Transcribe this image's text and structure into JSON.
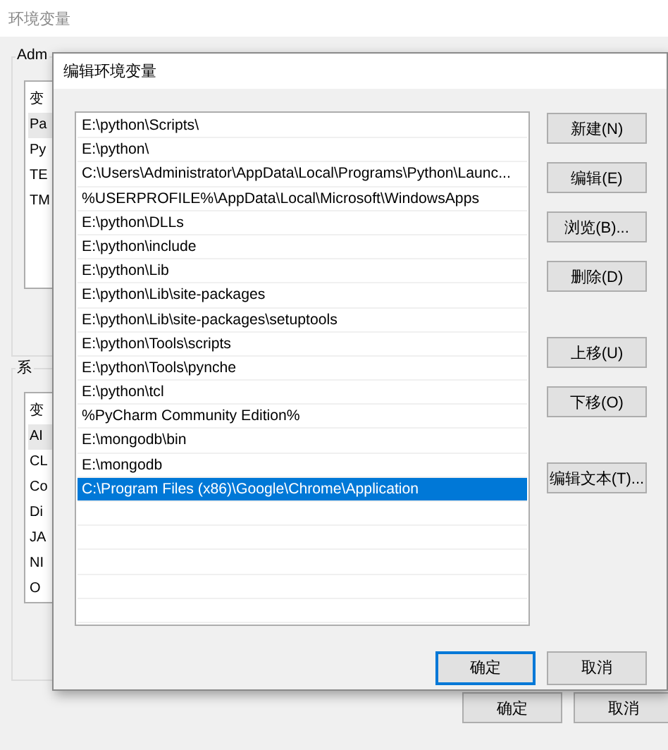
{
  "window": {
    "title": "环境变量"
  },
  "user_group": {
    "label": "Adm",
    "items": [
      {
        "text": "变",
        "selected": false
      },
      {
        "text": "Pa",
        "selected": true
      },
      {
        "text": "Py",
        "selected": false
      },
      {
        "text": "TE",
        "selected": false
      },
      {
        "text": "TM",
        "selected": false
      }
    ]
  },
  "system_group": {
    "label": "系",
    "items": [
      {
        "text": "变",
        "selected": false
      },
      {
        "text": "AI",
        "selected": true
      },
      {
        "text": "CL",
        "selected": false
      },
      {
        "text": "Co",
        "selected": false
      },
      {
        "text": "Di",
        "selected": false
      },
      {
        "text": "JA",
        "selected": false
      },
      {
        "text": "NI",
        "selected": false
      },
      {
        "text": "O",
        "selected": false
      }
    ]
  },
  "window_buttons": [
    "确定",
    "取消"
  ],
  "dialog": {
    "title": "编辑环境变量",
    "paths": [
      {
        "text": "E:\\python\\Scripts\\",
        "selected": false
      },
      {
        "text": "E:\\python\\",
        "selected": false
      },
      {
        "text": "C:\\Users\\Administrator\\AppData\\Local\\Programs\\Python\\Launc...",
        "selected": false
      },
      {
        "text": "%USERPROFILE%\\AppData\\Local\\Microsoft\\WindowsApps",
        "selected": false
      },
      {
        "text": "E:\\python\\DLLs",
        "selected": false
      },
      {
        "text": "E:\\python\\include",
        "selected": false
      },
      {
        "text": "E:\\python\\Lib",
        "selected": false
      },
      {
        "text": "E:\\python\\Lib\\site-packages",
        "selected": false
      },
      {
        "text": "E:\\python\\Lib\\site-packages\\setuptools",
        "selected": false
      },
      {
        "text": "E:\\python\\Tools\\scripts",
        "selected": false
      },
      {
        "text": "E:\\python\\Tools\\pynche",
        "selected": false
      },
      {
        "text": "E:\\python\\tcl",
        "selected": false
      },
      {
        "text": "%PyCharm Community Edition%",
        "selected": false
      },
      {
        "text": "E:\\mongodb\\bin",
        "selected": false
      },
      {
        "text": "E:\\mongodb",
        "selected": false
      },
      {
        "text": "C:\\Program Files (x86)\\Google\\Chrome\\Application",
        "selected": true
      }
    ],
    "side_button_groups": [
      [
        "新建(N)",
        "编辑(E)",
        "浏览(B)...",
        "删除(D)"
      ],
      [
        "上移(U)",
        "下移(O)"
      ],
      [
        "编辑文本(T)..."
      ]
    ],
    "footer_buttons": [
      {
        "label": "确定",
        "focused": true
      },
      {
        "label": "取消",
        "focused": false
      }
    ]
  }
}
